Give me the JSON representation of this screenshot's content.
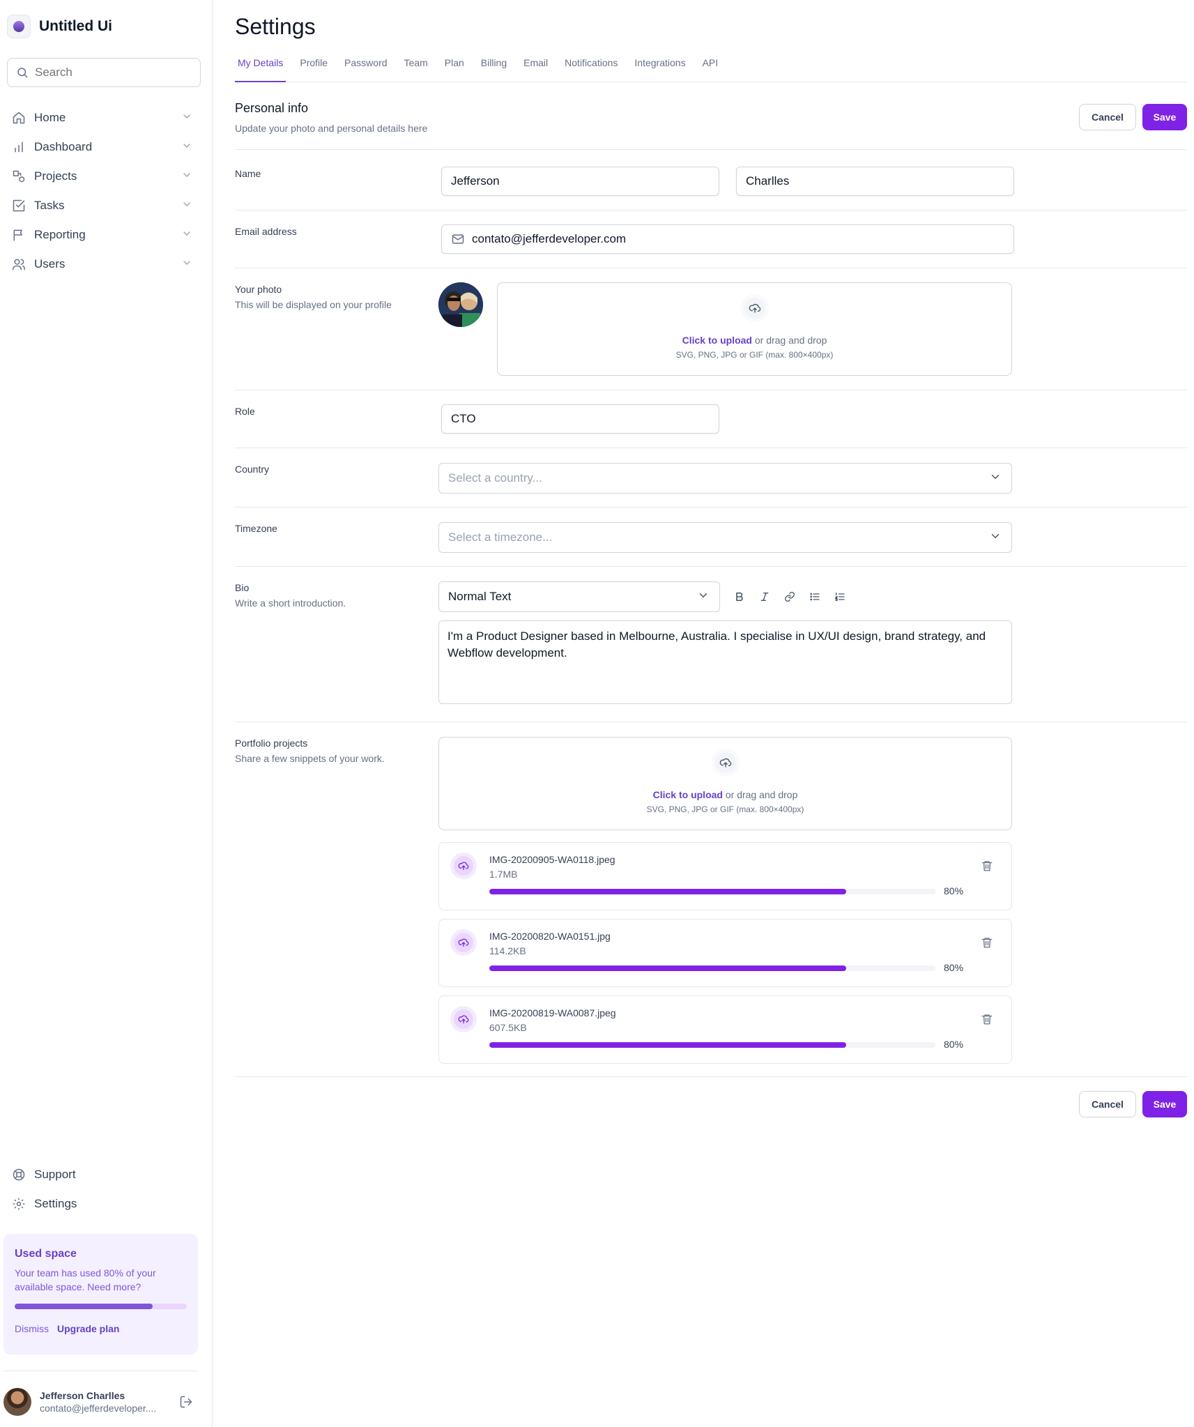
{
  "app": {
    "name": "Untitled Ui"
  },
  "search": {
    "placeholder": "Search"
  },
  "nav": {
    "items": [
      {
        "label": "Home"
      },
      {
        "label": "Dashboard"
      },
      {
        "label": "Projects"
      },
      {
        "label": "Tasks"
      },
      {
        "label": "Reporting"
      },
      {
        "label": "Users"
      }
    ],
    "bottom": [
      {
        "label": "Support"
      },
      {
        "label": "Settings"
      }
    ]
  },
  "usage": {
    "title": "Used space",
    "text": "Your team has used 80% of your available space. Need more?",
    "progress": 0.8,
    "dismiss": "Dismiss",
    "upgrade": "Upgrade plan"
  },
  "user": {
    "name": "Jefferson Charlles",
    "email": "contato@jefferdeveloper...."
  },
  "page": {
    "title": "Settings",
    "tabs": [
      "My Details",
      "Profile",
      "Password",
      "Team",
      "Plan",
      "Billing",
      "Email",
      "Notifications",
      "Integrations",
      "API"
    ],
    "active_tab": "My Details"
  },
  "personal": {
    "title": "Personal info",
    "subtitle": "Update your photo and personal details here",
    "cancel": "Cancel",
    "save": "Save"
  },
  "form": {
    "name": {
      "label": "Name",
      "first": "Jefferson",
      "last": "Charlles"
    },
    "email": {
      "label": "Email address",
      "value": "contato@jefferdeveloper.com"
    },
    "photo": {
      "label": "Your photo",
      "hint": "This will be displayed on your profile",
      "upload_link": "Click to upload",
      "upload_rest": " or drag and drop",
      "upload_formats": "SVG, PNG, JPG or GIF (max. 800×400px)"
    },
    "role": {
      "label": "Role",
      "value": "CTO"
    },
    "country": {
      "label": "Country",
      "placeholder": "Select a country..."
    },
    "timezone": {
      "label": "Timezone",
      "placeholder": "Select a timezone..."
    },
    "bio": {
      "label": "Bio",
      "hint": "Write a short introduction.",
      "format": "Normal Text",
      "text": "I'm a Product Designer based in Melbourne, Australia. I specialise in UX/UI design, brand strategy, and Webflow development."
    },
    "portfolio": {
      "label": "Portfolio projects",
      "hint": "Share a few snippets of your work.",
      "upload_link": "Click to upload",
      "upload_rest": " or drag and drop",
      "upload_formats": "SVG, PNG, JPG or GIF (max. 800×400px)",
      "files": [
        {
          "name": "IMG-20200905-WA0118.jpeg",
          "size": "1.7MB",
          "percent": "80%",
          "progress": 0.8
        },
        {
          "name": "IMG-20200820-WA0151.jpg",
          "size": "114.2KB",
          "percent": "80%",
          "progress": 0.8
        },
        {
          "name": "IMG-20200819-WA0087.jpeg",
          "size": "607.5KB",
          "percent": "80%",
          "progress": 0.8
        }
      ]
    }
  },
  "footer": {
    "cancel": "Cancel",
    "save": "Save"
  },
  "colors": {
    "accent": "#7f22e8",
    "accent_text": "#6941c6",
    "border": "#d0d5dd"
  }
}
